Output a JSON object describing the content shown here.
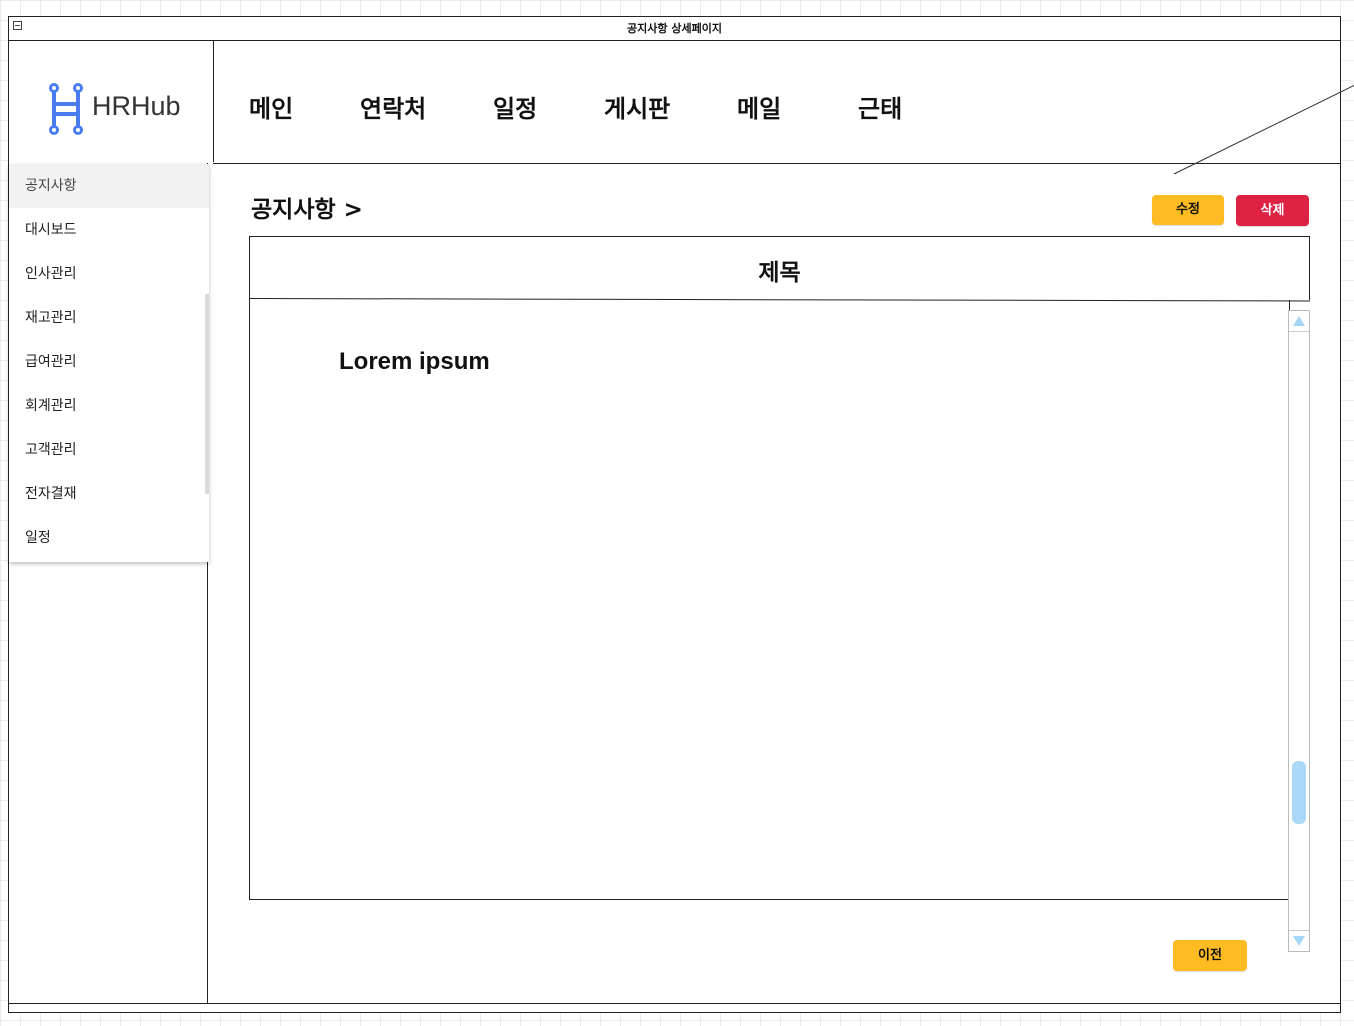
{
  "window": {
    "title": "공지사항 상세페이지"
  },
  "brand": {
    "name": "HRHub",
    "accent_color": "#4a7cf0"
  },
  "nav": {
    "items": [
      {
        "label": "메인"
      },
      {
        "label": "연락처"
      },
      {
        "label": "일정"
      },
      {
        "label": "게시판"
      },
      {
        "label": "메일"
      },
      {
        "label": "근태"
      }
    ]
  },
  "sidebar": {
    "items": [
      {
        "label": "공지사항",
        "active": true
      },
      {
        "label": "대시보드"
      },
      {
        "label": "인사관리"
      },
      {
        "label": "재고관리"
      },
      {
        "label": "급여관리"
      },
      {
        "label": "회계관리"
      },
      {
        "label": "고객관리"
      },
      {
        "label": "전자결재"
      },
      {
        "label": "일정"
      }
    ]
  },
  "page": {
    "breadcrumb": "공지사항 >",
    "edit_label": "수정",
    "delete_label": "삭제",
    "post_title": "제목",
    "post_body": "Lorem ipsum",
    "prev_label": "이전"
  },
  "colors": {
    "edit_button": "#ffbb22",
    "delete_button": "#dd2244",
    "prev_button": "#ffbb22",
    "scroll_thumb": "#aad8f8"
  }
}
